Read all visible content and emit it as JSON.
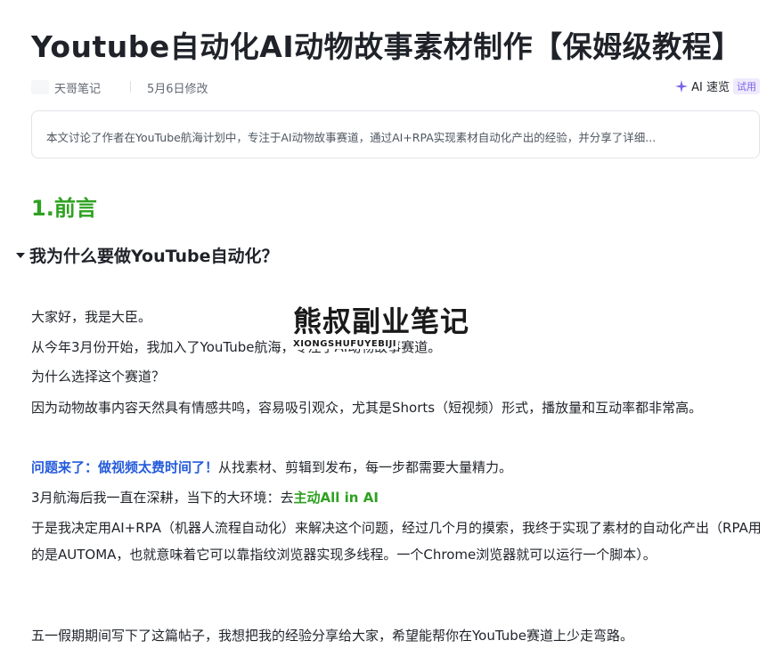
{
  "document": {
    "title": "Youtube自动化AI动物故事素材制作【保姆级教程】",
    "author": "天哥笔记",
    "modified": "5月6日修改",
    "ai_label": "AI 速览",
    "trial_badge": "试用",
    "summary": "本文讨论了作者在YouTube航海计划中，专注于AI动物故事赛道，通过AI+RPA实现素材自动化产出的经验，并分享了详细..."
  },
  "content": {
    "heading1": "1.前言",
    "heading2": "我为什么要做YouTube自动化？",
    "p1": "大家好，我是大臣。",
    "p2": "从今年3月份开始，我加入了YouTube航海，专注于AI动物故事赛道。",
    "p3": "为什么选择这个赛道？",
    "p4": "因为动物故事内容天然具有情感共鸣，容易吸引观众，尤其是Shorts（短视频）形式，播放量和互动率都非常高。",
    "p5_highlight": "问题来了：做视频太费时间了！",
    "p5_rest": "从找素材、剪辑到发布，每一步都需要大量精力。",
    "p6_prefix": "3月航海后我一直在深耕，当下的大环境：去",
    "p6_highlight": "主动All in AI",
    "p7": "于是我决定用AI+RPA（机器人流程自动化）来解决这个问题，经过几个月的摸索，我终于实现了素材的自动化产出（RPA用的是AUTOMA，也就意味着它可以靠指纹浏览器实现多线程。一个Chrome浏览器就可以运行一个脚本）。",
    "p8": "五一假期期间写下了这篇帖子，我想把我的经验分享给大家，希望能帮你在YouTube赛道上少走弯路。"
  },
  "watermark": {
    "main": "熊叔副业笔记",
    "sub": "XIONGSHUFUYEBIJI"
  },
  "colors": {
    "heading_green": "#2ea121",
    "highlight_blue": "#245bdb",
    "ai_purple": "#7a63e8"
  }
}
